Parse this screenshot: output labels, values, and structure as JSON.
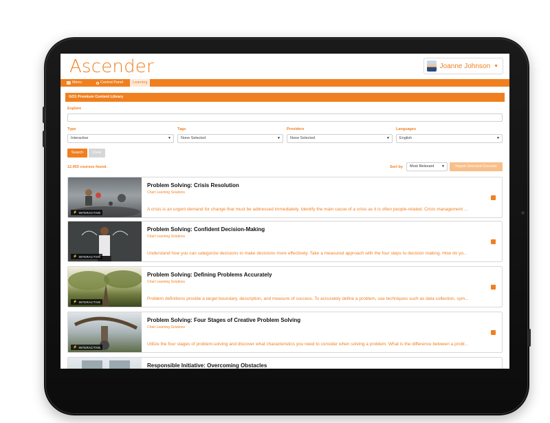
{
  "brand": {
    "logo_text": "Ascender",
    "accent": "#f07f1f"
  },
  "user": {
    "name": "Joanne Johnson"
  },
  "nav": {
    "items": [
      {
        "label": "Menu",
        "icon": "grid-icon"
      },
      {
        "label": "Control Panel",
        "icon": "gear-icon"
      },
      {
        "label": "Learning",
        "active": true
      }
    ]
  },
  "library": {
    "title": "GO1 Premium Content Library",
    "explore_label": "Explore",
    "explore_value": "",
    "filters": [
      {
        "label": "Type",
        "value": "Interactive"
      },
      {
        "label": "Tags",
        "value": "None Selected"
      },
      {
        "label": "Providers",
        "value": "None Selected"
      },
      {
        "label": "Languages",
        "value": "English"
      }
    ],
    "search_button": "Search",
    "clear_button": "Clear",
    "results_count": "12,403 courses found.",
    "sort_label": "Sort by",
    "sort_value": "Most Relevant",
    "import_button": "Import Selected Courses"
  },
  "courses": [
    {
      "title": "Problem Solving: Crisis Resolution",
      "provider": "Chart Learning Solutions",
      "description": "A crisis is an urgent demand for change that must be addressed immediately. Identify the main cause of a crisis as it is often people-related. Crisis management ...",
      "badge": "INTERACTIVE",
      "selected": true
    },
    {
      "title": "Problem Solving: Confident Decision-Making",
      "provider": "Chart Learning Solutions",
      "description": "Understand how you can categorize decisions to make decisions more effectively. Take a measured approach with the four steps to decision making. How do yo...",
      "badge": "INTERACTIVE",
      "selected": true
    },
    {
      "title": "Problem Solving: Defining Problems Accurately",
      "provider": "Chart Learning Solutions",
      "description": "Problem definitions provide a target boundary, description, and measure of success. To accurately define a problem, use techniques such as data collection, sym...",
      "badge": "INTERACTIVE",
      "selected": true
    },
    {
      "title": "Problem Solving: Four Stages of Creative Problem Solving",
      "provider": "Chart Learning Solutions",
      "description": "Utilize the four stages of problem-solving and discover what characteristics you need to consider when solving a problem. What is the difference between a probl...",
      "badge": "INTERACTIVE",
      "selected": true
    },
    {
      "title": "Responsible Initiative: Overcoming Obstacles",
      "provider": "",
      "description": "",
      "badge": "",
      "selected": false
    }
  ]
}
